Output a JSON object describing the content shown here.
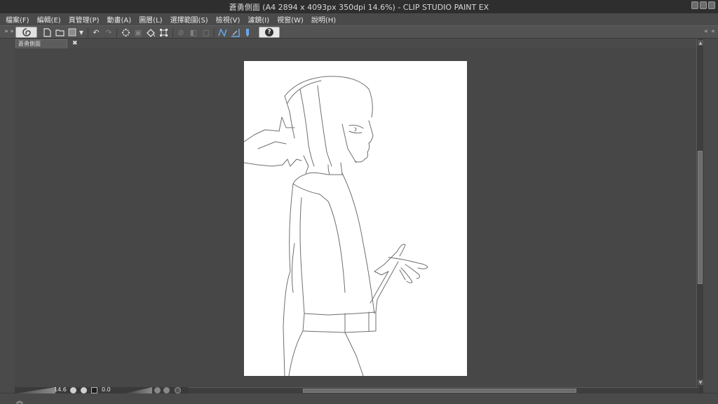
{
  "window": {
    "title": "蒼勇側面 (A4 2894 x 4093px 350dpi 14.6%)  - CLIP STUDIO PAINT EX"
  },
  "menu": [
    "檔案(F)",
    "編輯(E)",
    "頁管理(P)",
    "動畫(A)",
    "圖層(L)",
    "選擇範圍(S)",
    "檢視(V)",
    "濾鏡(I)",
    "視窗(W)",
    "說明(H)"
  ],
  "document_tab": {
    "label": "蒼勇側面"
  },
  "status": {
    "zoom": "14.6",
    "rotation": "0.0"
  },
  "icons": {
    "logo": "clip-studio-logo-icon",
    "help": "help-icon"
  }
}
